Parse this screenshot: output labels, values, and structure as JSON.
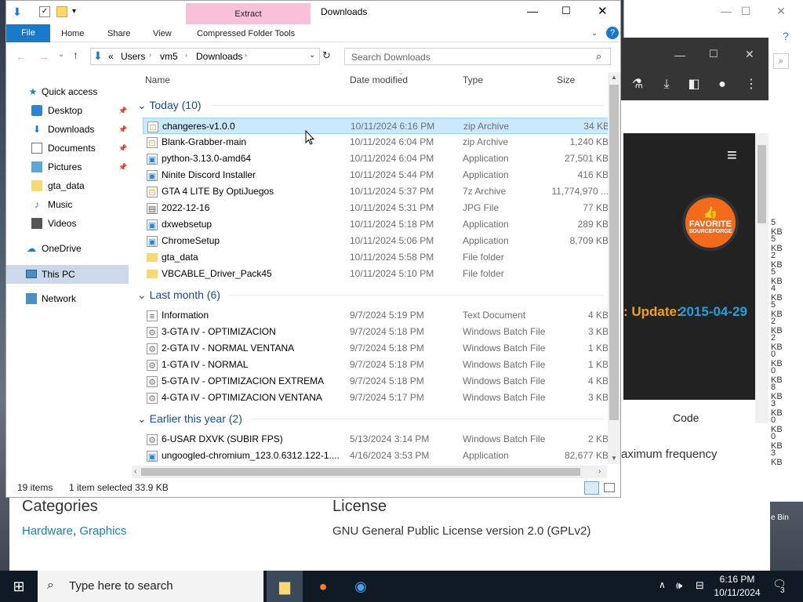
{
  "explorer": {
    "title": "Downloads",
    "extract_tab": "Extract",
    "ribbon_tabs": [
      "File",
      "Home",
      "Share",
      "View",
      "Compressed Folder Tools"
    ],
    "address": {
      "prefix": "«",
      "parts": [
        "Users",
        "vm5",
        "Downloads"
      ]
    },
    "search_placeholder": "Search Downloads",
    "nav": {
      "quick_access": "Quick access",
      "desktop": "Desktop",
      "downloads": "Downloads",
      "documents": "Documents",
      "pictures": "Pictures",
      "gta_data": "gta_data",
      "music": "Music",
      "videos": "Videos",
      "onedrive": "OneDrive",
      "this_pc": "This PC",
      "network": "Network"
    },
    "columns": {
      "name": "Name",
      "date": "Date modified",
      "type": "Type",
      "size": "Size"
    },
    "groups": {
      "today": "Today (10)",
      "last_month": "Last month (6)",
      "earlier": "Earlier this year (2)"
    },
    "rows": [
      {
        "name": "changeres-v1.0.0",
        "date": "10/11/2024 6:16 PM",
        "type": "zip Archive",
        "size": "34 KB"
      },
      {
        "name": "Blank-Grabber-main",
        "date": "10/11/2024 6:04 PM",
        "type": "zip Archive",
        "size": "1,240 KB"
      },
      {
        "name": "python-3.13.0-amd64",
        "date": "10/11/2024 6:04 PM",
        "type": "Application",
        "size": "27,501 KB"
      },
      {
        "name": "Ninite Discord Installer",
        "date": "10/11/2024 5:44 PM",
        "type": "Application",
        "size": "416 KB"
      },
      {
        "name": "GTA 4 LITE By OptiJuegos",
        "date": "10/11/2024 5:37 PM",
        "type": "7z Archive",
        "size": "11,774,970 ..."
      },
      {
        "name": "2022-12-16",
        "date": "10/11/2024 5:31 PM",
        "type": "JPG File",
        "size": "77 KB"
      },
      {
        "name": "dxwebsetup",
        "date": "10/11/2024 5:18 PM",
        "type": "Application",
        "size": "289 KB"
      },
      {
        "name": "ChromeSetup",
        "date": "10/11/2024 5:06 PM",
        "type": "Application",
        "size": "8,709 KB"
      },
      {
        "name": "gta_data",
        "date": "10/11/2024 5:58 PM",
        "type": "File folder",
        "size": ""
      },
      {
        "name": "VBCABLE_Driver_Pack45",
        "date": "10/11/2024 5:10 PM",
        "type": "File folder",
        "size": ""
      },
      {
        "name": "Information",
        "date": "9/7/2024 5:19 PM",
        "type": "Text Document",
        "size": "4 KB"
      },
      {
        "name": "3-GTA IV - OPTIMIZACION",
        "date": "9/7/2024 5:18 PM",
        "type": "Windows Batch File",
        "size": "3 KB"
      },
      {
        "name": "2-GTA IV - NORMAL VENTANA",
        "date": "9/7/2024 5:18 PM",
        "type": "Windows Batch File",
        "size": "1 KB"
      },
      {
        "name": "1-GTA IV - NORMAL",
        "date": "9/7/2024 5:18 PM",
        "type": "Windows Batch File",
        "size": "1 KB"
      },
      {
        "name": "5-GTA IV - OPTIMIZACION EXTREMA",
        "date": "9/7/2024 5:18 PM",
        "type": "Windows Batch File",
        "size": "4 KB"
      },
      {
        "name": "4-GTA IV - OPTIMIZACION VENTANA",
        "date": "9/7/2024 5:17 PM",
        "type": "Windows Batch File",
        "size": "3 KB"
      },
      {
        "name": "6-USAR DXVK (SUBIR FPS)",
        "date": "5/13/2024 3:14 PM",
        "type": "Windows Batch File",
        "size": "2 KB"
      },
      {
        "name": "ungoogled-chromium_123.0.6312.122-1....",
        "date": "4/16/2024 3:53 PM",
        "type": "Application",
        "size": "82,677 KB"
      }
    ],
    "status": {
      "items": "19 items",
      "selected": "1 item selected",
      "size": "33.9 KB"
    }
  },
  "browser": {
    "favorite": "FAVORITE",
    "sourceforge": "SOURCEFORGE",
    "update_label": ": Update:",
    "update_date": "2015-04-29",
    "code_tab": "Code",
    "freq_text": "aximum frequency",
    "categories_title": "Categories",
    "categories_hw": "Hardware",
    "categories_sep": ", ",
    "categories_gfx": "Graphics",
    "license_title": "License",
    "license_value": "GNU General Public License version 2.0 (GPLv2)"
  },
  "back_window": {
    "kb_values": [
      "5 KB",
      "5 KB",
      "2 KB",
      "5 KB",
      "4 KB",
      "5 KB",
      "2 KB",
      "2 KB",
      "0 KB",
      "0 KB",
      "8 KB",
      "3 KB",
      "0 KB",
      "0 KB",
      "3 KB"
    ],
    "recycle_bin": "e Bin"
  },
  "taskbar": {
    "search_placeholder": "Type here to search",
    "time": "6:16 PM",
    "date": "10/11/2024",
    "notifications": "3"
  }
}
